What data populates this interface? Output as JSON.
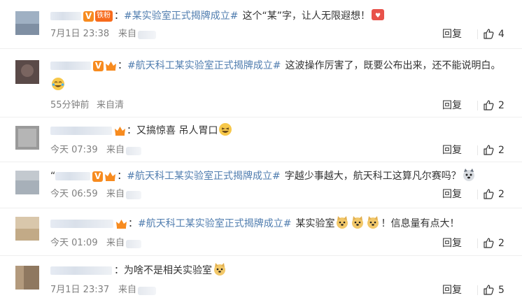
{
  "labels": {
    "colon": "：",
    "from": "来自",
    "reply": "回复"
  },
  "comments": [
    {
      "fan_badge": "铁粉",
      "topic": "#某实验室正式揭牌成立#",
      "text": "这个“某”字，让人无限遐想！",
      "emoji": "heart-face-emoji",
      "time": "7月1日 23:38",
      "likes": "4"
    },
    {
      "topic": "#航天科工某实验室正式揭牌成立#",
      "text": "这波操作厉害了，既要公布出来，还不能说明白。",
      "emoji": "crying-laugh-emoji",
      "time": "55分钟前",
      "from_partial": "来自清",
      "likes": "2"
    },
    {
      "text": "又搞惊喜 吊人胃口",
      "emoji": "laughing-emoji",
      "time": "今天 07:39",
      "likes": "2"
    },
    {
      "name_prefix": "“",
      "topic": "#航天科工某实验室正式揭牌成立#",
      "text": "字越少事越大，航天科工这算凡尔赛吗？",
      "emoji": "husky-dog-emoji",
      "time": "今天 06:59",
      "likes": "2"
    },
    {
      "topic": "#航天科工某实验室正式揭牌成立#",
      "text_before": "某实验室",
      "text_after": "！信息量有点大！",
      "emoji": "doge-emoji",
      "time": "今天 01:09",
      "likes": "2"
    },
    {
      "text": "为啥不是相关实验室",
      "emoji": "doge-emoji",
      "time": "7月1日 23:37",
      "likes": "5"
    }
  ],
  "colors": {
    "topic": "#eb7350",
    "meta": "#808080",
    "text": "#333333",
    "vip": "#f78b1f"
  }
}
